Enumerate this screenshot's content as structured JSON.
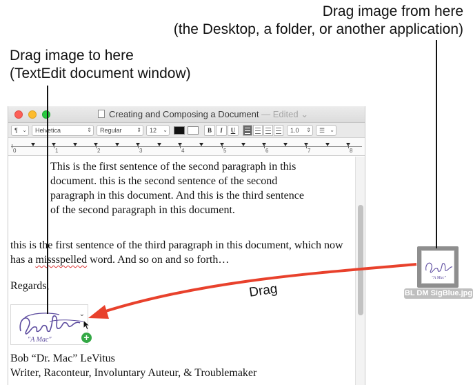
{
  "callouts": {
    "source_line1": "Drag image from here",
    "source_line2": "(the Desktop, a folder, or another application)",
    "target_line1": "Drag image to here",
    "target_line2": "(TextEdit document window)",
    "drag_label": "Drag"
  },
  "window": {
    "title": "Creating and Composing a Document",
    "title_status": "— Edited ⌄"
  },
  "format_bar": {
    "paragraph_style": "¶",
    "font_family": "Helvetica",
    "font_style": "Regular",
    "font_size": "12",
    "bold_label": "B",
    "italic_label": "I",
    "underline_label": "U",
    "line_spacing": "1.0",
    "list_style": "☰"
  },
  "ruler": {
    "numbers": [
      "0",
      "1",
      "2",
      "3",
      "4",
      "5",
      "6",
      "7",
      "8"
    ]
  },
  "document": {
    "paragraph2": "This is the first sentence of the second paragraph in this document. this is the second sentence of the second paragraph in this document. And this is the third sentence of the second paragraph in this document.",
    "paragraph3_before": "this is the first sentence of the third paragraph in this document, which now has a ",
    "paragraph3_misspelled": "missspelled",
    "paragraph3_after": " word. And so on and so forth…",
    "regards": "Regards,",
    "signature_name": "Bob “Dr. Mac” LeVitus",
    "signature_title": "Writer, Raconteur, Involuntary Auteur, & Troublemaker",
    "signature_menu": "⌄",
    "plus_badge": "+"
  },
  "desktop_file": {
    "filename": "BL DM SigBlue.jpg"
  },
  "colors": {
    "arrow": "#e8412c",
    "close": "#fc5f57",
    "minimize": "#fdbc2e",
    "maximize": "#28c840",
    "signature_ink": "#5b4a9e"
  }
}
